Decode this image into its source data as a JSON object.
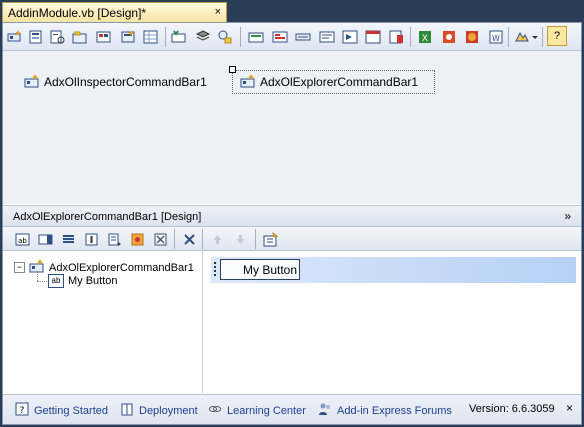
{
  "document_tab": {
    "title": "AddinModule.vb [Design]*",
    "close": "×"
  },
  "top_toolbar": {
    "icons": [
      "new-commandbar-icon",
      "new-explorer-commandbar-icon",
      "new-inspector-commandbar-icon",
      "new-ribbon-tab-icon",
      "new-ribbon-qat-icon",
      "new-office-menu-icon",
      "new-form-region-icon",
      "keyboard-shortcut-icon",
      "events-icon",
      "app-events-icon",
      "ribbon-tab-icon",
      "ribbon-group-icon",
      "ribbon-button-icon",
      "ribbon-menu-icon",
      "ribbon-gallery-icon",
      "task-pane-icon",
      "form-region-icon",
      "excel-icon",
      "outlook-icon",
      "powerpoint-icon",
      "word-icon",
      "visio-icon",
      "more-dropdown-icon"
    ],
    "help_label": "?"
  },
  "surface": {
    "components": [
      {
        "label": "AdxOlInspectorCommandBar1"
      },
      {
        "label": "AdxOlExplorerCommandBar1"
      }
    ]
  },
  "lower_designer": {
    "title": "AdxOlExplorerCommandBar1 [Design]",
    "collapse_glyph": "»",
    "toolbar_icons": [
      "add-button-icon",
      "add-combobox-icon",
      "add-edit-icon",
      "add-label-icon",
      "add-popup-icon",
      "add-control-icon",
      "add-admin-icon",
      "delete-icon",
      "move-up-icon",
      "move-down-icon",
      "properties-icon"
    ]
  },
  "tree": {
    "root": {
      "label": "AdxOlExplorerCommandBar1",
      "toggle": "−"
    },
    "child": {
      "label": "My Button",
      "badge": "ab"
    }
  },
  "preview": {
    "button_label": "My Button"
  },
  "status_bar": {
    "links": [
      {
        "label": "Getting Started",
        "icon": "help-icon"
      },
      {
        "label": "Deployment",
        "icon": "book-icon"
      },
      {
        "label": "Learning Center",
        "icon": "link-icon"
      },
      {
        "label": "Add-in Express Forums",
        "icon": "users-icon"
      }
    ],
    "version": "Version: 6.6.3059",
    "close": "×"
  },
  "colors": {
    "frame_bg": "#2b3c59",
    "tab_gold": "#f7e3a0",
    "surface": "#edf0f4",
    "link": "#1f3d91",
    "strip": "#b7d0f5"
  }
}
